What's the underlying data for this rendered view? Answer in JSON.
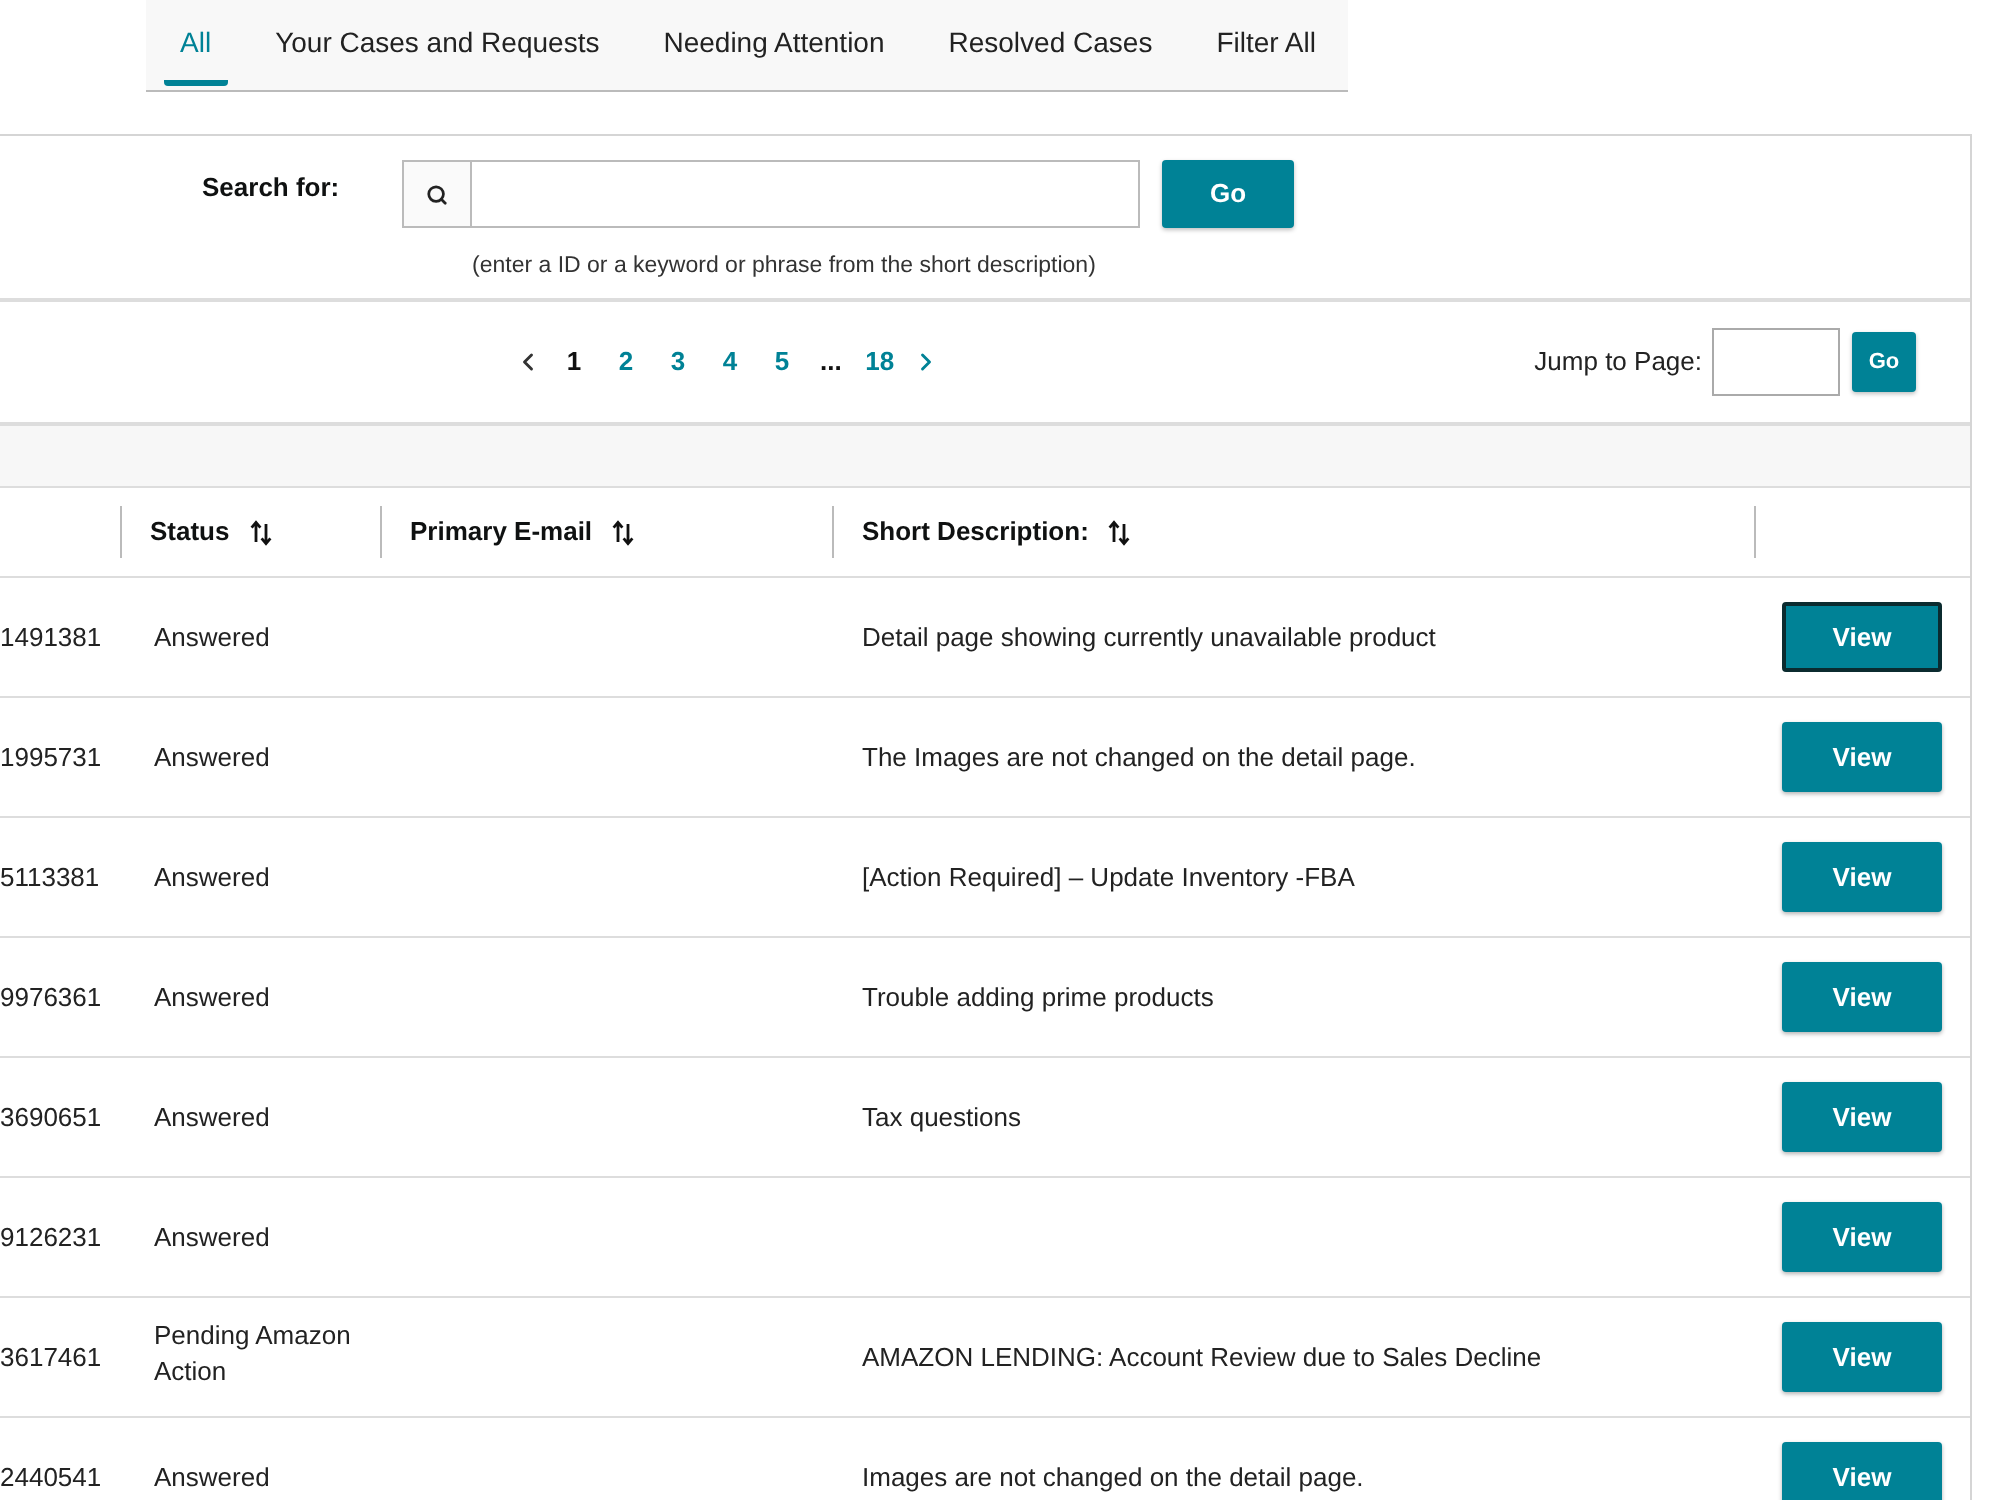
{
  "tabs": [
    {
      "label": "All",
      "selected": true
    },
    {
      "label": "Your Cases and Requests",
      "selected": false
    },
    {
      "label": "Needing Attention",
      "selected": false
    },
    {
      "label": "Resolved Cases",
      "selected": false
    },
    {
      "label": "Filter All",
      "selected": false
    }
  ],
  "search": {
    "label": "Search for:",
    "button": "Go",
    "hint": "(enter a ID or a keyword or phrase from the short description)"
  },
  "pagination": {
    "previous": {
      "disabled": true
    },
    "items": [
      {
        "kind": "page",
        "label": "1",
        "selected": true
      },
      {
        "kind": "page",
        "label": "2",
        "selected": false
      },
      {
        "kind": "page",
        "label": "3",
        "selected": false
      },
      {
        "kind": "page",
        "label": "4",
        "selected": false
      },
      {
        "kind": "page",
        "label": "5",
        "selected": false
      },
      {
        "kind": "ellipsis",
        "label": "..."
      },
      {
        "kind": "page",
        "label": "18",
        "selected": false
      }
    ],
    "next": {
      "disabled": false
    }
  },
  "jump_to_page": {
    "label": "Jump to Page:",
    "button": "Go"
  },
  "table": {
    "columns": [
      {
        "label": "Status"
      },
      {
        "label": "Primary E-mail"
      },
      {
        "label": "Short Description:"
      }
    ],
    "rows": [
      {
        "id": "1491381",
        "status": "Answered",
        "description": "Detail page showing currently unavailable product",
        "button": "View",
        "focused": true
      },
      {
        "id": "1995731",
        "status": "Answered",
        "description": "The Images are not changed on the detail page.",
        "button": "View",
        "focused": false
      },
      {
        "id": "5113381",
        "status": "Answered",
        "description": "[Action Required] – Update Inventory -FBA",
        "button": "View",
        "focused": false
      },
      {
        "id": "9976361",
        "status": "Answered",
        "description": "Trouble adding prime products",
        "button": "View",
        "focused": false
      },
      {
        "id": "3690651",
        "status": "Answered",
        "description": "Tax questions",
        "button": "View",
        "focused": false
      },
      {
        "id": "9126231",
        "status": "Answered",
        "button": "View",
        "focused": false
      },
      {
        "id": "3617461",
        "status": "Pending Amazon Action",
        "description": "AMAZON LENDING: Account Review due to Sales Decline",
        "button": "View",
        "focused": false
      },
      {
        "id": "2440541",
        "status": "Answered",
        "description": "Images are not changed on the detail page.",
        "button": "View",
        "focused": false
      }
    ]
  }
}
